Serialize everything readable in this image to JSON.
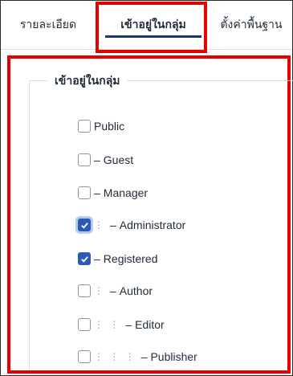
{
  "tabs": [
    {
      "label": "รายละเอียด"
    },
    {
      "label": "เข้าอยู่ในกลุ่ม",
      "active": true
    },
    {
      "label": "ตั้งค่าพื้นฐาน"
    }
  ],
  "group_fieldset": {
    "legend": "เข้าอยู่ในกลุ่ม",
    "groups": [
      {
        "name": "Public",
        "prefix": "",
        "dots": "",
        "checked": false
      },
      {
        "name": "Guest",
        "prefix": "–",
        "dots": "",
        "checked": false
      },
      {
        "name": "Manager",
        "prefix": "–",
        "dots": "",
        "checked": false
      },
      {
        "name": "Administrator",
        "prefix": "–",
        "dots": "⋮",
        "checked": true
      },
      {
        "name": "Registered",
        "prefix": "–",
        "dots": "",
        "checked": true
      },
      {
        "name": "Author",
        "prefix": "–",
        "dots": "⋮",
        "checked": false
      },
      {
        "name": "Editor",
        "prefix": "–",
        "dots": "⋮ ⋮",
        "checked": false
      },
      {
        "name": "Publisher",
        "prefix": "–",
        "dots": "⋮ ⋮ ⋮",
        "checked": false
      }
    ]
  },
  "colors": {
    "highlight": "#e60000",
    "checkbox_checked": "#2b5bb7",
    "active_tab_underline": "#1a3867"
  }
}
